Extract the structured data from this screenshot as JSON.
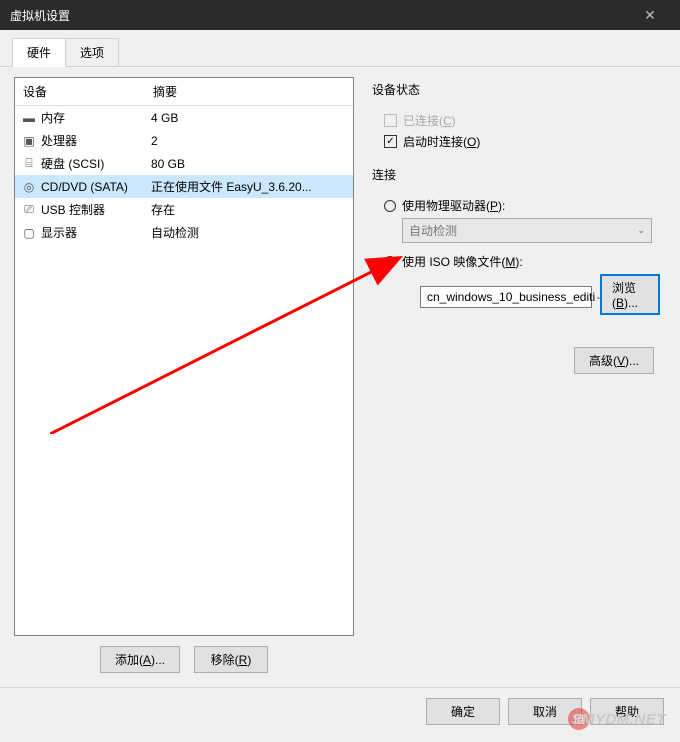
{
  "window": {
    "title": "虚拟机设置",
    "close": "✕"
  },
  "tabs": {
    "hardware": "硬件",
    "options": "选项"
  },
  "listHeader": {
    "device": "设备",
    "summary": "摘要"
  },
  "devices": [
    {
      "icon": "▬",
      "name": "内存",
      "summary": "4 GB"
    },
    {
      "icon": "▣",
      "name": "处理器",
      "summary": "2"
    },
    {
      "icon": "⌸",
      "name": "硬盘 (SCSI)",
      "summary": "80 GB"
    },
    {
      "icon": "◎",
      "name": "CD/DVD (SATA)",
      "summary": "正在使用文件 EasyU_3.6.20..."
    },
    {
      "icon": "⎚",
      "name": "USB 控制器",
      "summary": "存在"
    },
    {
      "icon": "▢",
      "name": "显示器",
      "summary": "自动检测"
    }
  ],
  "leftButtons": {
    "add": "添加(A)...",
    "remove": "移除(R)"
  },
  "right": {
    "statusGroup": "设备状态",
    "connected": "已连接(C)",
    "connectAtPower": "启动时连接(O)",
    "connectGroup": "连接",
    "physicalDrive": "使用物理驱动器(P):",
    "autoDetect": "自动检测",
    "useIso": "使用 ISO 映像文件(M):",
    "isoValue": "cn_windows_10_business_editi",
    "browse": "浏览(B)...",
    "advanced": "高级(V)..."
  },
  "footer": {
    "ok": "确定",
    "cancel": "取消",
    "help": "帮助"
  },
  "watermark": {
    "text": "SMYDM.NET",
    "badge": "值"
  }
}
